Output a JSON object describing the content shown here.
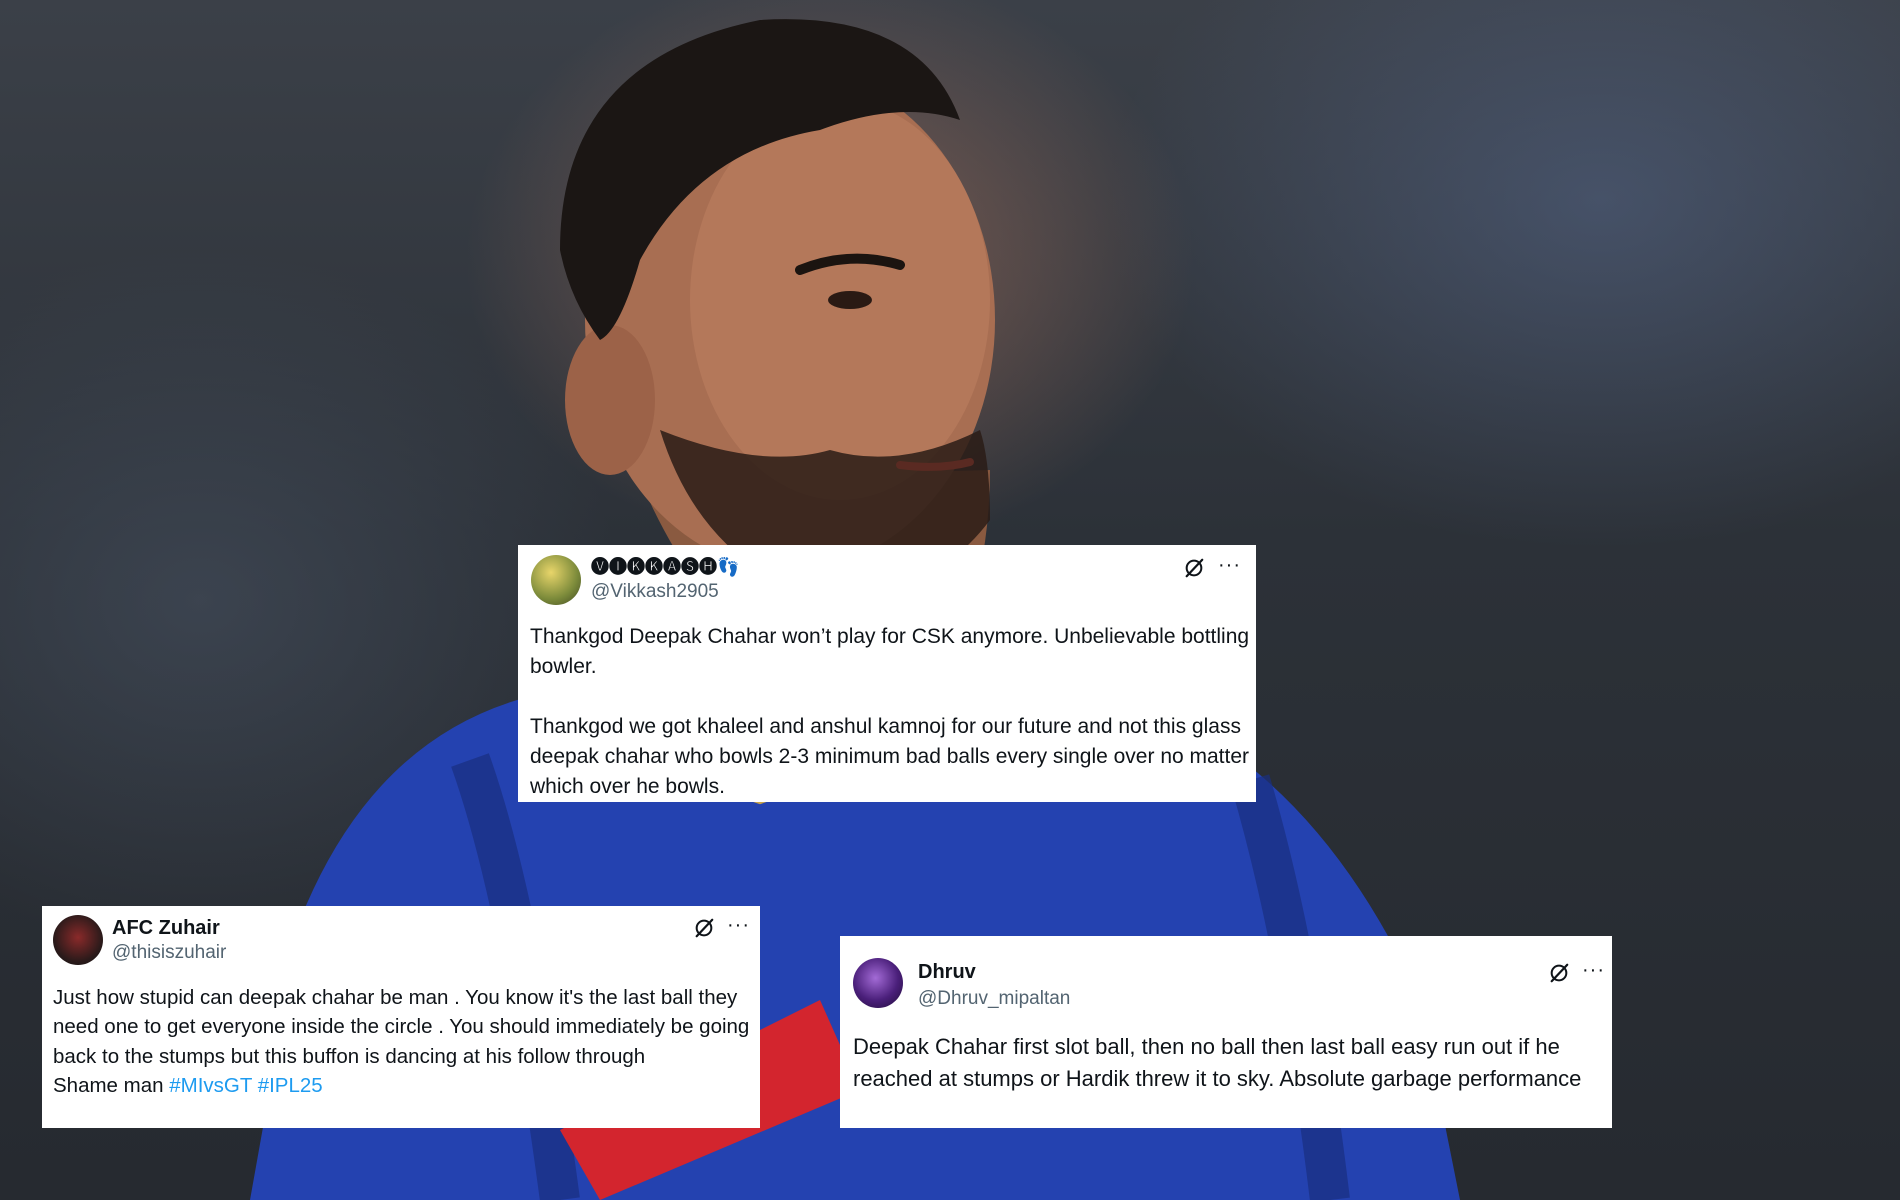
{
  "tweets": [
    {
      "name": "🅥🅘🅚🅚🅐🅢🅗👣",
      "handle": "@Vikkash2905",
      "text": "Thankgod Deepak Chahar won’t play for CSK anymore. Unbelievable bottling bowler.\n\nThankgod we got khaleel and anshul kamnoj for our future and not this glass deepak chahar who bowls 2-3 minimum bad balls every single over no matter which over he bowls."
    },
    {
      "name": "AFC Zuhair",
      "handle": "@thisiszuhair",
      "text": "Just how stupid can deepak chahar be man . You know it's the last ball they need one to get everyone inside the circle . You should immediately be going back to the stumps but this buffon is dancing at his follow through\nShame man ",
      "hashtags": "#MIvsGT #IPL25"
    },
    {
      "name": "Dhruv",
      "handle": "@Dhruv_mipaltan",
      "text": "Deepak Chahar first slot ball, then no ball then last ball easy run out if he reached at stumps or Hardik threw it to sky. Absolute garbage performance"
    }
  ],
  "more_glyph": "···",
  "colors": {
    "link": "#1d9bf0",
    "handle": "#536471",
    "jersey": "#1f3fa8"
  }
}
